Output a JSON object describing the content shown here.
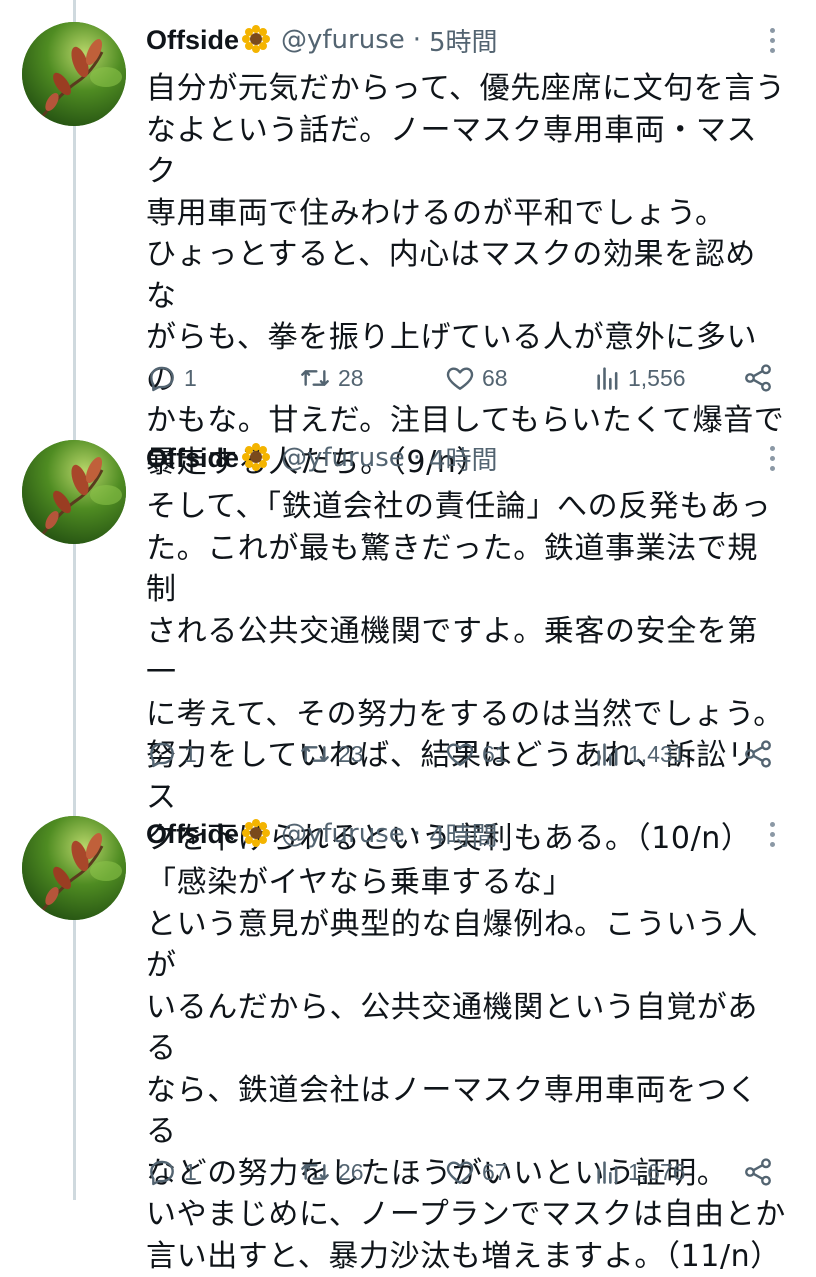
{
  "tweets": [
    {
      "name": "Offside",
      "handle": "@yfuruse",
      "time": "5時間",
      "text": "自分が元気だからって、優先座席に文句を言う\nなよという話だ。ノーマスク専用車両・マスク\n専用車両で住みわけるのが平和でしょう。\nひょっとすると、内心はマスクの効果を認めな\nがらも、拳を振り上げている人が意外に多いの\nかもな。甘えだ。注目してもらいたくて爆音で\n暴走する人たち。（9/n）",
      "replies": "1",
      "retweets": "28",
      "likes": "68",
      "views": "1,556"
    },
    {
      "name": "Offside",
      "handle": "@yfuruse",
      "time": "4時間",
      "text": "そして、「鉄道会社の責任論」への反発もあっ\nた。これが最も驚きだった。鉄道事業法で規制\nされる公共交通機関ですよ。乗客の安全を第一\nに考えて、その努力をするのは当然でしょう。\n努力をしていれば、結果はどうあれ、訴訟リス\nクを下げられるという実利もある。（10/n）",
      "replies": "1",
      "retweets": "23",
      "likes": "61",
      "views": "1,431"
    },
    {
      "name": "Offside",
      "handle": "@yfuruse",
      "time": "4時間",
      "text": "「感染がイヤなら乗車するな」\nという意見が典型的な自爆例ね。こういう人が\nいるんだから、公共交通機関という自覚がある\nなら、鉄道会社はノーマスク専用車両をつくる\nなどの努力をしたほうがいいという証明。\nいやまじめに、ノープランでマスクは自由とか\n言い出すと、暴力沙汰も増えますよ。（11/n）",
      "replies": "1",
      "retweets": "26",
      "likes": "67",
      "views": "1,676"
    }
  ],
  "icons": {
    "flower": "sunflower-emoji",
    "reply": "reply-icon",
    "retweet": "retweet-icon",
    "like": "heart-icon",
    "views": "views-chart-icon",
    "share": "share-icon",
    "more": "more-dots-icon"
  },
  "colors": {
    "text": "#0f1419",
    "secondary": "#536471",
    "thread_line": "#cfd9de"
  }
}
